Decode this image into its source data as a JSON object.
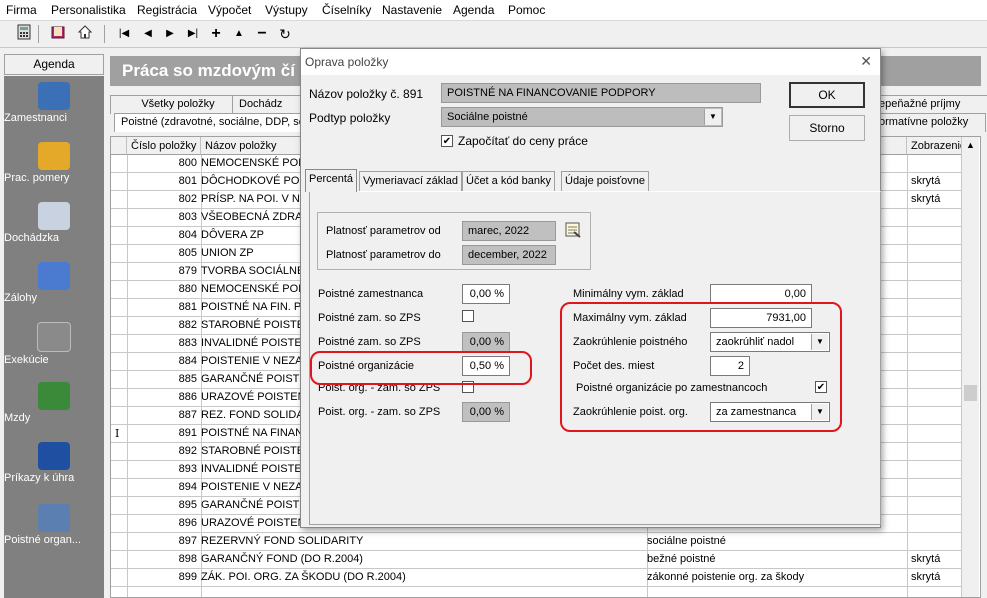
{
  "menu": [
    "Firma",
    "Personalistika",
    "Registrácia",
    "Výpočet",
    "Výstupy",
    "Číselníky",
    "Nastavenie",
    "Agenda",
    "Pomoc"
  ],
  "toolbar": {
    "nav_first": "|◀",
    "nav_prev": "◀",
    "nav_next": "▶",
    "nav_last": "▶|",
    "add": "+",
    "up": "▲",
    "remove": "−",
    "refresh": "↻"
  },
  "agenda": {
    "header": "Agenda",
    "items": [
      {
        "label": "Zamestnanci",
        "icon": "employees-icon",
        "color": "#3b6fb6"
      },
      {
        "label": "Prac. pomery",
        "icon": "work-relations-icon",
        "color": "#e5a92a"
      },
      {
        "label": "Dochádzka",
        "icon": "attendance-icon",
        "color": "#c9d2e0"
      },
      {
        "label": "Zálohy",
        "icon": "advances-icon",
        "color": "#4b7bd1"
      },
      {
        "label": "Exekúcie",
        "icon": "execution-icon",
        "color": "#8a8a8a"
      },
      {
        "label": "Mzdy",
        "icon": "wages-icon",
        "color": "#3a8a3a"
      },
      {
        "label": "Príkazy k úhra",
        "icon": "sepa-icon",
        "color": "#1f4fa0"
      },
      {
        "label": "Poistné organ...",
        "icon": "insurance-org-icon",
        "color": "#5a7fb0"
      }
    ]
  },
  "main": {
    "title": "Práca so mzdovým čí",
    "tabs_row1": [
      "Všetky položky",
      "Dochádz",
      "epeňažné príjmy"
    ],
    "tabs_row2": [
      "Poistné (zdravotné, sociálne, DDP, so",
      "ormatívne položky"
    ],
    "columns": {
      "num": "Číslo položky",
      "name": "Názov položky",
      "disp": "Zobrazenie"
    },
    "rows": [
      {
        "num": "800",
        "name": "NEMOCENSKÉ POIST",
        "type": "",
        "disp": ""
      },
      {
        "num": "801",
        "name": "DÔCHODKOVÉ POIS",
        "type": "",
        "disp": "skrytá"
      },
      {
        "num": "802",
        "name": "PRÍSP. NA POI. V N",
        "type": "",
        "disp": "skrytá"
      },
      {
        "num": "803",
        "name": "VŠEOBECNÁ ZDRAV",
        "type": "",
        "disp": ""
      },
      {
        "num": "804",
        "name": "DÔVERA ZP",
        "type": "",
        "disp": ""
      },
      {
        "num": "805",
        "name": "UNION ZP",
        "type": "",
        "disp": ""
      },
      {
        "num": "879",
        "name": "TVORBA SOCIÁLNE",
        "type": "",
        "disp": ""
      },
      {
        "num": "880",
        "name": "NEMOCENSKÉ POIS",
        "type": "",
        "disp": ""
      },
      {
        "num": "881",
        "name": "POISTNÉ NA FIN. P",
        "type": "",
        "disp": ""
      },
      {
        "num": "882",
        "name": "STAROBNÉ POISTE",
        "type": "",
        "disp": ""
      },
      {
        "num": "883",
        "name": "INVALIDNÉ POISTE",
        "type": "",
        "disp": ""
      },
      {
        "num": "884",
        "name": "POISTENIE V NEZA",
        "type": "",
        "disp": ""
      },
      {
        "num": "885",
        "name": "GARANČNÉ POISTE",
        "type": "",
        "disp": ""
      },
      {
        "num": "886",
        "name": "URAZOVÉ POISTEN",
        "type": "",
        "disp": ""
      },
      {
        "num": "887",
        "name": "REZ. FOND SOLIDA",
        "type": "",
        "disp": ""
      },
      {
        "num": "891",
        "name": "POISTNÉ NA FINAN",
        "type": "",
        "disp": "",
        "marker": "I"
      },
      {
        "num": "892",
        "name": "STAROBNÉ POISTE",
        "type": "",
        "disp": ""
      },
      {
        "num": "893",
        "name": "INVALIDNÉ POISTE",
        "type": "",
        "disp": ""
      },
      {
        "num": "894",
        "name": "POISTENIE V NEZA",
        "type": "",
        "disp": ""
      },
      {
        "num": "895",
        "name": "GARANČNÉ POISTE",
        "type": "",
        "disp": ""
      },
      {
        "num": "896",
        "name": "URAZOVÉ POISTEN",
        "type": "",
        "disp": ""
      },
      {
        "num": "897",
        "name": "REZERVNÝ FOND SOLIDARITY",
        "type": "sociálne poistné",
        "disp": ""
      },
      {
        "num": "898",
        "name": "GARANČNÝ FOND (DO R.2004)",
        "type": "bežné poistné",
        "disp": "skrytá"
      },
      {
        "num": "899",
        "name": "ZÁK. POI. ORG. ZA ŠKODU (DO R.2004)",
        "type": "zákonné poistenie org. za škody",
        "disp": "skrytá"
      }
    ]
  },
  "dialog": {
    "title": "Oprava položky",
    "name_label": "Názov položky č.  891",
    "name_value": "POISTNÉ NA FINANCOVANIE PODPORY",
    "subtype_label": "Podtyp položky",
    "subtype_value": "Sociálne poistné",
    "include_label": "Započítať do ceny práce",
    "include_checked": "✔",
    "ok_label": "OK",
    "cancel_label": "Storno",
    "tabs": [
      "Percentá",
      "Vymeriavací základ",
      "Účet a kód banky",
      "Údaje poisťovne"
    ],
    "valid_from_label": "Platnosť parametrov od",
    "valid_from_value": "marec, 2022",
    "valid_to_label": "Platnosť parametrov do",
    "valid_to_value": "december, 2022",
    "left_fields": [
      {
        "label": "Poistné zamestnanca",
        "value": "0,00 %",
        "kind": "input"
      },
      {
        "label": "Poistné zam. so ZPS",
        "value": "",
        "kind": "check"
      },
      {
        "label": "Poistné zam. so ZPS",
        "value": "0,00 %",
        "kind": "readonly"
      },
      {
        "label": "Poistné organizácie",
        "value": "0,50 %",
        "kind": "input"
      },
      {
        "label": "Poist. org. - zam. so ZPS",
        "value": "",
        "kind": "check"
      },
      {
        "label": "Poist. org. - zam. so ZPS",
        "value": "0,00 %",
        "kind": "readonly"
      }
    ],
    "min_base_label": "Minimálny vym. základ",
    "min_base_value": "0,00",
    "max_base_label": "Maximálny vym. základ",
    "max_base_value": "7931,00",
    "rounding_label": "Zaokrúhlenie poistného",
    "rounding_value": "zaokrúhliť nadol",
    "decimals_label": "Počet des. miest",
    "decimals_value": "2",
    "org_after_emp_label": "Poistné organizácie po zamestnancoch",
    "org_after_emp_checked": "✔",
    "org_rounding_label": "Zaokrúhlenie poist. org.",
    "org_rounding_value": "za zamestnanca",
    "highlight_color": "#e0161e"
  }
}
